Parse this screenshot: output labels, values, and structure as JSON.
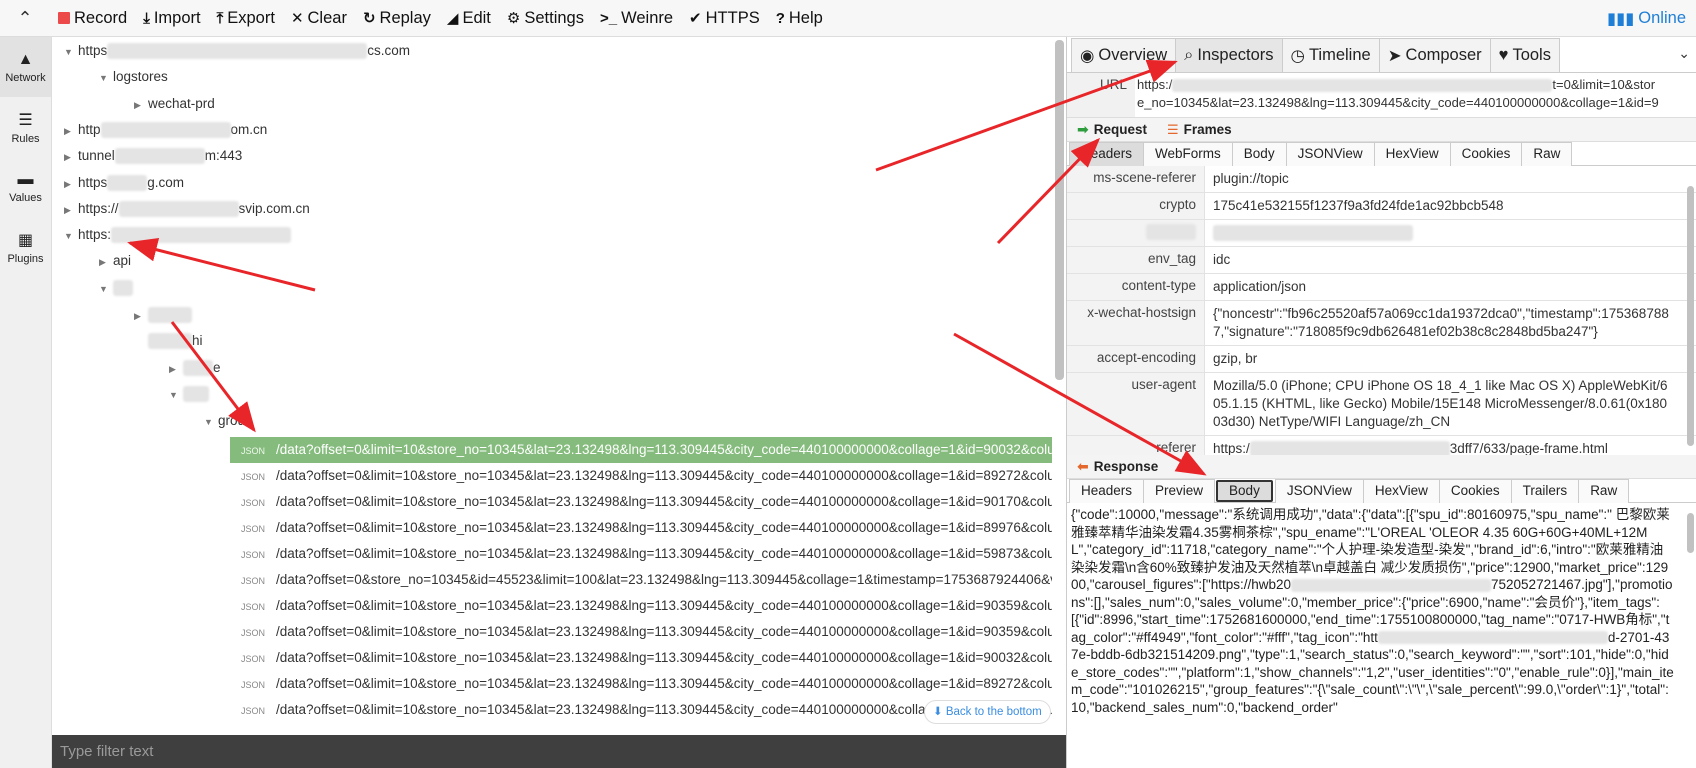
{
  "toolbar": {
    "buttons": [
      {
        "label": "Record",
        "icon": "record-icon"
      },
      {
        "label": "Import",
        "icon": "import-icon"
      },
      {
        "label": "Export",
        "icon": "export-icon"
      },
      {
        "label": "Clear",
        "icon": "clear-icon"
      },
      {
        "label": "Replay",
        "icon": "replay-icon"
      },
      {
        "label": "Edit",
        "icon": "edit-icon"
      },
      {
        "label": "Settings",
        "icon": "gear-icon"
      },
      {
        "label": "Weinre",
        "icon": "terminal-icon"
      },
      {
        "label": "HTTPS",
        "icon": "check-icon"
      },
      {
        "label": "Help",
        "icon": "help-icon"
      }
    ],
    "status": "Online"
  },
  "sidebar": {
    "items": [
      {
        "label": "Network",
        "icon": "tree-icon"
      },
      {
        "label": "Rules",
        "icon": "list-icon"
      },
      {
        "label": "Values",
        "icon": "folder-icon"
      },
      {
        "label": "Plugins",
        "icon": "plugin-icon"
      }
    ]
  },
  "tree": {
    "nodes": [
      {
        "prefix": "https",
        "suffix": "cs.com"
      },
      {
        "label": "logstores"
      },
      {
        "label": "wechat-prd"
      },
      {
        "prefix": "http",
        "suffix": "om.cn"
      },
      {
        "prefix": "tunnel",
        "suffix": "m:443"
      },
      {
        "prefix": "https",
        "suffix": "g.com"
      },
      {
        "prefix": "https://",
        "suffix": "svip.com.cn"
      },
      {
        "prefix": "https:"
      },
      {
        "label": "api"
      },
      {
        "label": "hi"
      },
      {
        "label": "e"
      },
      {
        "label": "grou"
      }
    ],
    "json_tag": "JSON",
    "rows": [
      "/data?offset=0&limit=10&store_no=10345&lat=23.132498&lng=113.309445&city_code=440100000000&collage=1&id=90032&colum",
      "/data?offset=0&limit=10&store_no=10345&lat=23.132498&lng=113.309445&city_code=440100000000&collage=1&id=89272&colum",
      "/data?offset=0&limit=10&store_no=10345&lat=23.132498&lng=113.309445&city_code=440100000000&collage=1&id=90170&colum",
      "/data?offset=0&limit=10&store_no=10345&lat=23.132498&lng=113.309445&city_code=440100000000&collage=1&id=89976&colum",
      "/data?offset=0&limit=10&store_no=10345&lat=23.132498&lng=113.309445&city_code=440100000000&collage=1&id=59873&colum",
      "/data?offset=0&store_no=10345&id=45523&limit=100&lat=23.132498&lng=113.309445&collage=1&timestamp=1753687924406&ve",
      "/data?offset=0&limit=10&store_no=10345&lat=23.132498&lng=113.309445&city_code=440100000000&collage=1&id=90359&colum",
      "/data?offset=0&limit=10&store_no=10345&lat=23.132498&lng=113.309445&city_code=440100000000&collage=1&id=90359&colum",
      "/data?offset=0&limit=10&store_no=10345&lat=23.132498&lng=113.309445&city_code=440100000000&collage=1&id=90032&colum",
      "/data?offset=0&limit=10&store_no=10345&lat=23.132498&lng=113.309445&city_code=440100000000&collage=1&id=89272&colum",
      "/data?offset=0&limit=10&store_no=10345&lat=23.132498&lng=113.309445&city_code=440100000000&collage=1&id=90358&colum"
    ],
    "back_to_bottom": "Back to the bottom"
  },
  "filter": {
    "placeholder": "Type filter text"
  },
  "panel": {
    "tabs": [
      {
        "label": "Overview",
        "icon": "eye-icon"
      },
      {
        "label": "Inspectors",
        "icon": "search-icon"
      },
      {
        "label": "Timeline",
        "icon": "clock-icon"
      },
      {
        "label": "Composer",
        "icon": "send-icon"
      },
      {
        "label": "Tools",
        "icon": "heart-icon"
      }
    ],
    "url_key": "URL",
    "url_line1_a": "https:/",
    "url_line1_b": "t=0&limit=10&stor",
    "url_line2": "e_no=10345&lat=23.132498&lng=113.309445&city_code=440100000000&collage=1&id=9",
    "request_label": "Request",
    "frames_label": "Frames",
    "request_tabs": [
      "Headers",
      "WebForms",
      "Body",
      "JSONView",
      "HexView",
      "Cookies",
      "Raw"
    ],
    "headers": [
      {
        "key": "ms-scene-referer",
        "value": "plugin://topic"
      },
      {
        "key": "crypto",
        "value": "175c41e532155f1237f9a3fd24fde1ac92bbcb548"
      },
      {
        "key": "",
        "value": ""
      },
      {
        "key": "env_tag",
        "value": "idc"
      },
      {
        "key": "content-type",
        "value": "application/json"
      },
      {
        "key": "x-wechat-hostsign",
        "value": "{\"noncestr\":\"fb96c25520af57a069cc1da19372dca0\",\"timestamp\":1753687887,\"signature\":\"718085f9c9db626481ef02b38c8c2848bd5ba247\"}"
      },
      {
        "key": "accept-encoding",
        "value": "gzip, br"
      },
      {
        "key": "user-agent",
        "value": "Mozilla/5.0 (iPhone; CPU iPhone OS 18_4_1 like Mac OS X) AppleWebKit/605.1.15 (KHTML, like Gecko) Mobile/15E148 MicroMessenger/8.0.61(0x18003d30) NetType/WIFI Language/zh_CN"
      },
      {
        "key": "referer",
        "value": "https:/"
      }
    ],
    "referer_tail": "3dff7/633/page-frame.html",
    "response_label": "Response",
    "response_tabs": [
      "Headers",
      "Preview",
      "Body",
      "JSONView",
      "HexView",
      "Cookies",
      "Trailers",
      "Raw"
    ],
    "body_part1": "{\"code\":10000,\"message\":\"系统调用成功\",\"data\":{\"data\":[{\"spu_id\":80160975,\"spu_name\":\" 巴黎欧莱雅臻萃精华油染发霜4.35雾桐茶棕\",\"spu_ename\":\"L'OREAL 'OLEOR 4.35 60G+60G+40ML+12ML\",\"category_id\":11718,\"category_name\":\"个人护理-染发造型-染发\",\"brand_id\":6,\"intro\":\"欧莱雅精油染染发霜\\n含60%致臻护发油及天然植萃\\n卓越盖白 减少发质损伤\",\"price\":12900,\"market_price\":12900,\"carousel_figures\":[\"https://hwb20",
    "body_part2": "752052721467.jpg\"],\"promotions\":[],\"sales_num\":0,\"sales_volume\":0,\"member_price\":{\"price\":6900,\"name\":\"会员价\"},\"item_tags\":[{\"id\":8996,\"start_time\":1752681600000,\"end_time\":1755100800000,\"tag_name\":\"0717-HWB角标\",\"tag_color\":\"#ff4949\",\"font_color\":\"#fff\",\"tag_icon\":\"htt",
    "body_part3": "d-2701-437e-bddb-6db321514209.png\",\"type\":1,\"search_status\":0,\"search_keyword\":\"\",\"sort\":101,\"hide\":0,\"hide_store_codes\":\"\",\"platform\":1,\"show_channels\":\"1,2\",\"user_identities\":\"0\",\"enable_rule\":0}],\"main_item_code\":\"101026215\",\"group_features\":\"{\\\"sale_count\\\":\\\"\\\",\\\"sale_percent\\\":99.0,\\\"order\\\":1}\",\"total\":10,\"backend_sales_num\":0,\"backend_order\""
  },
  "colors": {
    "selected_row": "#85bb7d",
    "arrow": "#e8262a",
    "accent": "#1f7fd6"
  }
}
